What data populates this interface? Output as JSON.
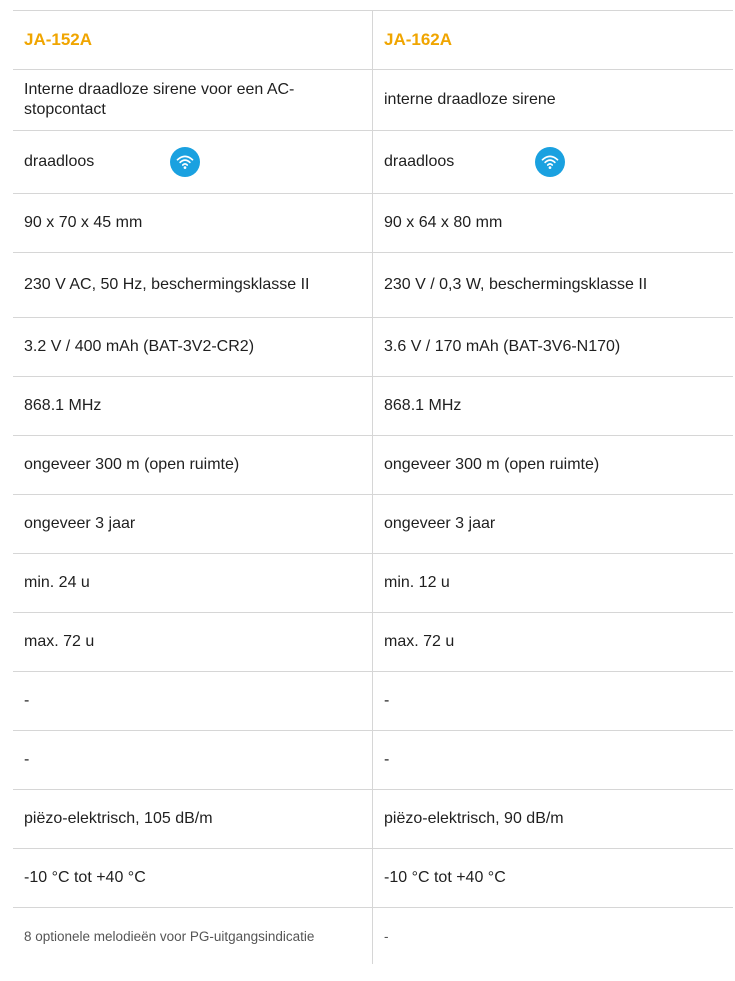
{
  "columns": [
    "JA-152A",
    "JA-162A"
  ],
  "rows": [
    [
      "Interne draadloze sirene voor een AC-stopcontact",
      "interne draadloze sirene"
    ],
    [
      "draadloos",
      "draadloos"
    ],
    [
      "90 x 70 x 45 mm",
      "90 x 64 x 80 mm"
    ],
    [
      "230 V AC, 50 Hz, beschermingsklasse II",
      "230 V / 0,3 W, beschermingsklasse II"
    ],
    [
      "3.2 V / 400 mAh (BAT-3V2-CR2)",
      "3.6 V / 170 mAh (BAT-3V6-N170)"
    ],
    [
      "868.1 MHz",
      "868.1 MHz"
    ],
    [
      "ongeveer 300 m (open ruimte)",
      "ongeveer 300 m (open ruimte)"
    ],
    [
      "ongeveer 3 jaar",
      "ongeveer 3 jaar"
    ],
    [
      "min. 24 u",
      "min. 12 u"
    ],
    [
      "max. 72 u",
      "max. 72 u"
    ],
    [
      "-",
      "-"
    ],
    [
      "-",
      "-"
    ],
    [
      "piëzo-elektrisch, 105 dB/m",
      "piëzo-elektrisch, 90 dB/m"
    ],
    [
      " -10 °C tot +40 °C",
      " -10 °C tot +40 °C"
    ],
    [
      "8 optionele melodieën voor PG-uitgangsindicatie",
      "-"
    ]
  ],
  "icons": {
    "wireless": "wifi-icon"
  },
  "colors": {
    "header": "#f0a500",
    "wifi_badge": "#1aa1e0",
    "border": "#d6d6d6"
  }
}
